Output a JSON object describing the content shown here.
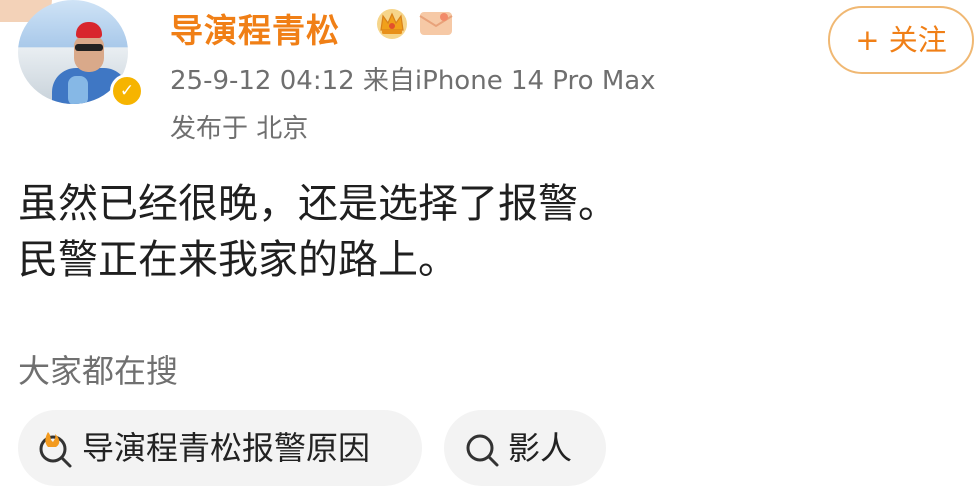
{
  "post": {
    "username": "导演程青松",
    "time_source": "25-9-12 04:12  来自iPhone 14 Pro Max",
    "location": "发布于 北京",
    "follow_label": "+ 关注",
    "lines": [
      "虽然已经很晚，还是选择了报警。",
      "民警正在来我家的路上。"
    ]
  },
  "search": {
    "title": "大家都在搜",
    "chips": [
      {
        "label": "导演程青松报警原因",
        "icon": "hot-search-icon"
      },
      {
        "label": "影人",
        "icon": "search-icon"
      }
    ]
  },
  "icons": {
    "verified": "verified-badge-icon",
    "crown": "crown-icon",
    "envelope": "envelope-icon"
  },
  "colors": {
    "accent": "#f07f16",
    "follow_border": "#f0b873",
    "meta_text": "#6f6f6f",
    "chip_bg": "#f3f3f3",
    "verified": "#f6b400"
  }
}
